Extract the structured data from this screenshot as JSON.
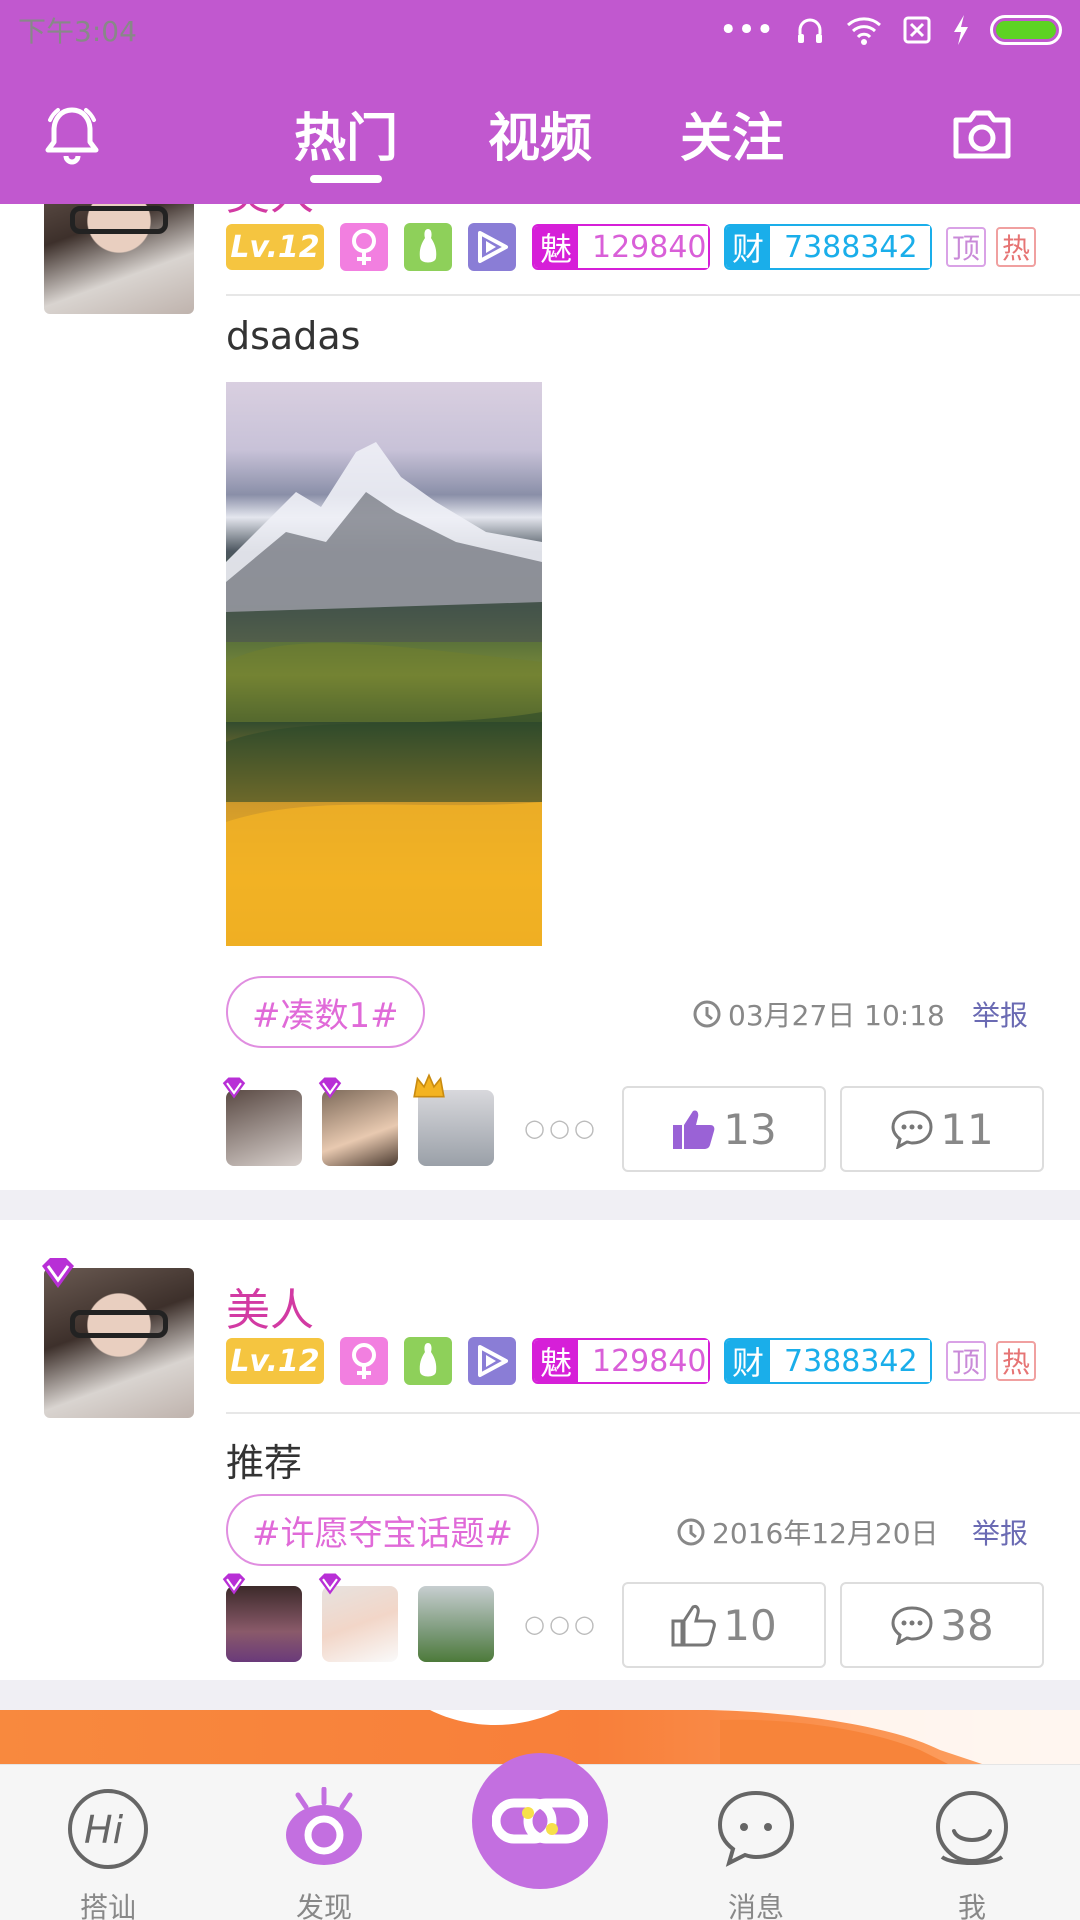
{
  "status": {
    "time": "下午3:04"
  },
  "header": {
    "tabs": [
      {
        "label": "热门",
        "active": true
      },
      {
        "label": "视频",
        "active": false
      },
      {
        "label": "关注",
        "active": false
      }
    ],
    "left_icon": "bell-icon",
    "right_icon": "camera-icon"
  },
  "posts": [
    {
      "name": "美人",
      "level": "Lv.12",
      "charm_key": "魅",
      "charm": "129840",
      "wealth_key": "财",
      "wealth": "7388342",
      "top_label": "顶",
      "hot_label": "热",
      "text": "dsadas",
      "tag": "#凑数1#",
      "time": "03月27日 10:18",
      "report": "举报",
      "likes": "13",
      "comments": "11",
      "liker_more": "○○○"
    },
    {
      "name": "美人",
      "level": "Lv.12",
      "charm_key": "魅",
      "charm": "129840",
      "wealth_key": "财",
      "wealth": "7388342",
      "top_label": "顶",
      "hot_label": "热",
      "text": "推荐",
      "tag": "#许愿夺宝话题#",
      "time": "2016年12月20日",
      "report": "举报",
      "likes": "10",
      "comments": "38",
      "liker_more": "○○○"
    }
  ],
  "bottom_nav": [
    {
      "label": "搭讪",
      "icon": "hi-icon"
    },
    {
      "label": "发现",
      "icon": "discover-eye-icon"
    },
    {
      "label": "",
      "icon": "link-center-icon"
    },
    {
      "label": "消息",
      "icon": "chat-bubble-icon"
    },
    {
      "label": "我",
      "icon": "profile-icon"
    }
  ],
  "colors": {
    "primary": "#c158cf",
    "name": "#d23aa3",
    "charm": "#d61fd8",
    "wealth": "#1aaeea"
  }
}
